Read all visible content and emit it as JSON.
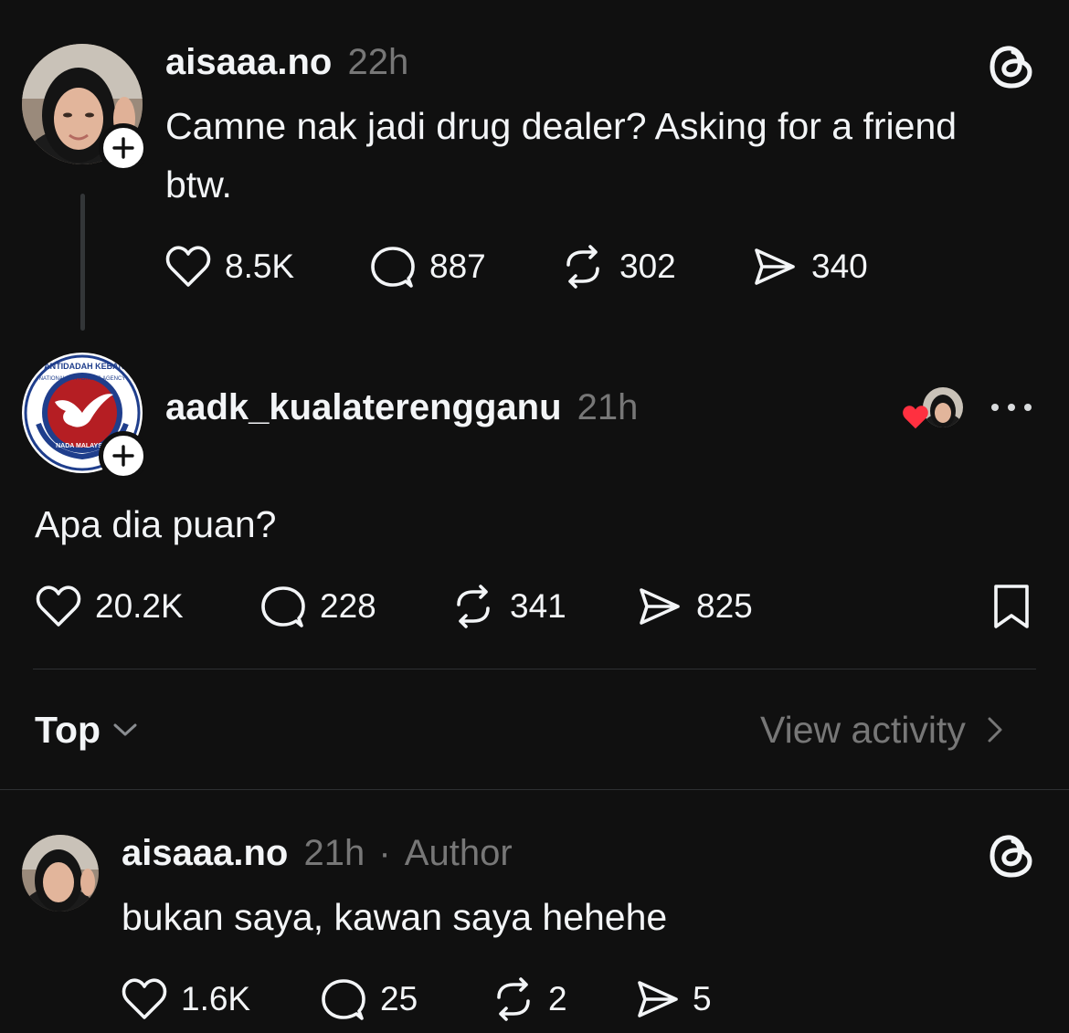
{
  "post": {
    "username": "aisaaa.no",
    "time": "22h",
    "text": "Camne nak jadi drug dealer? Asking for a friend btw.",
    "likes": "8.5K",
    "comments": "887",
    "reposts": "302",
    "shares": "340",
    "avatar_icon": "person-avatar",
    "logo_icon": "threads-icon"
  },
  "reply": {
    "username": "aadk_kualaterengganu",
    "time": "21h",
    "text": "Apa dia puan?",
    "likes": "20.2K",
    "comments": "228",
    "reposts": "341",
    "shares": "825",
    "logo_text_top": "AGENSI ANTIDADAH KEBANGSAAN",
    "logo_text_inner": "NATIONAL ANTI-DRUGS AGENCY",
    "logo_text_bottom": "NADA MALAYSIA",
    "liked_by_author_color": "#ff3040"
  },
  "sort": {
    "label": "Top",
    "view_activity": "View activity"
  },
  "comment": {
    "username": "aisaaa.no",
    "time": "21h",
    "separator": "·",
    "badge": "Author",
    "text": "bukan saya, kawan saya hehehe",
    "likes": "1.6K",
    "comments": "25",
    "reposts": "2",
    "shares": "5"
  }
}
